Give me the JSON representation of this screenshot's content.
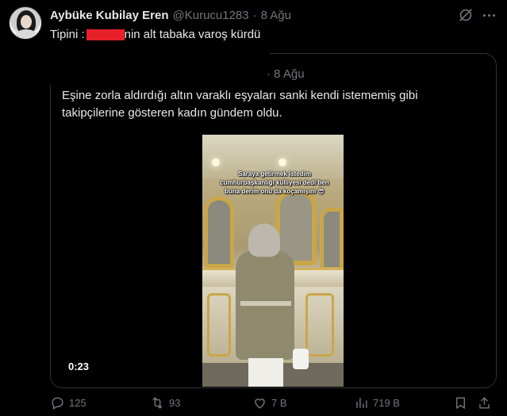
{
  "author": {
    "name": "Aybüke Kubilay Eren",
    "handle": "@Kurucu1283",
    "separator": "·",
    "date": "8 Ağu"
  },
  "tweet": {
    "text_before": "Tipini :",
    "text_after": "nin alt tabaka varoş kürdü"
  },
  "quote": {
    "date": "8 Ağu",
    "separator": "·",
    "text": "Eşine zorla aldırdığı altın varaklı eşyaları sanki kendi istememiş gibi takipçilerine gösteren kadın gündem oldu.",
    "video": {
      "overlay_text": "Saraya getirmek istedim cumhurbaşkanlığı külliyesi dedi ben buna derim onu da koçamışım 😎",
      "duration": "0:23"
    }
  },
  "actions": {
    "replies": "125",
    "retweets": "93",
    "likes": "7 B",
    "views": "719 B"
  },
  "colors": {
    "background": "#000000",
    "text": "#e7e9ea",
    "muted": "#71767b",
    "border": "#2f3336",
    "redaction": "#e8202a"
  },
  "icons": [
    "grok-icon",
    "more-icon",
    "reply-icon",
    "retweet-icon",
    "like-icon",
    "views-icon",
    "bookmark-icon",
    "share-icon"
  ]
}
